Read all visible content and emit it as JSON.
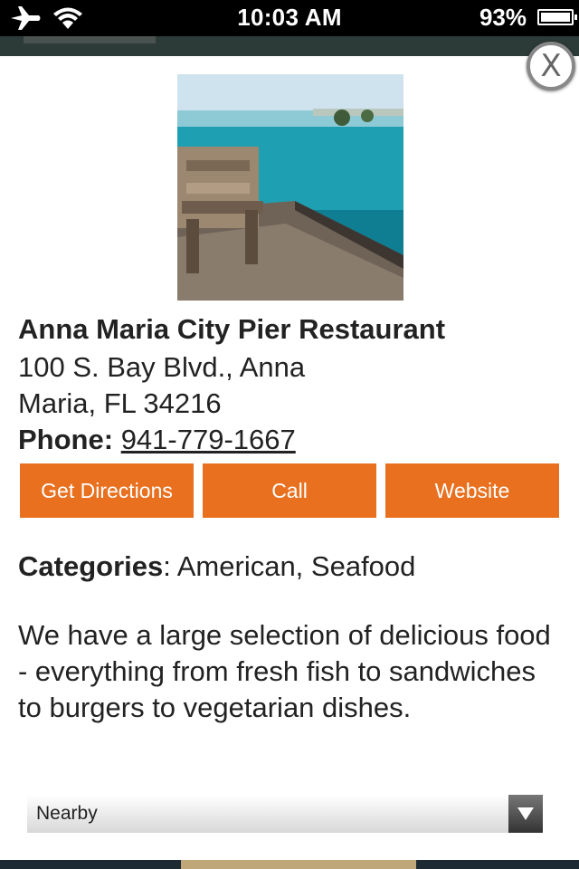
{
  "status_bar": {
    "time": "10:03 AM",
    "battery": "93%"
  },
  "listing": {
    "name": "Anna Maria City Pier Restaurant",
    "address_line1": "100 S. Bay Blvd., Anna",
    "address_line2": "Maria, FL 34216",
    "phone_label": "Phone:",
    "phone": "941-779-1667",
    "categories_label": "Categories",
    "categories_value": ": American, Seafood",
    "description": "We have a large selection of delicious food - everything from fresh fish to sandwiches to burgers to vegetarian dishes."
  },
  "buttons": {
    "directions": "Get Directions",
    "call": "Call",
    "website": "Website"
  },
  "close_label": "X",
  "nearby": {
    "selected": "Nearby"
  },
  "colors": {
    "accent": "#e8701f"
  }
}
